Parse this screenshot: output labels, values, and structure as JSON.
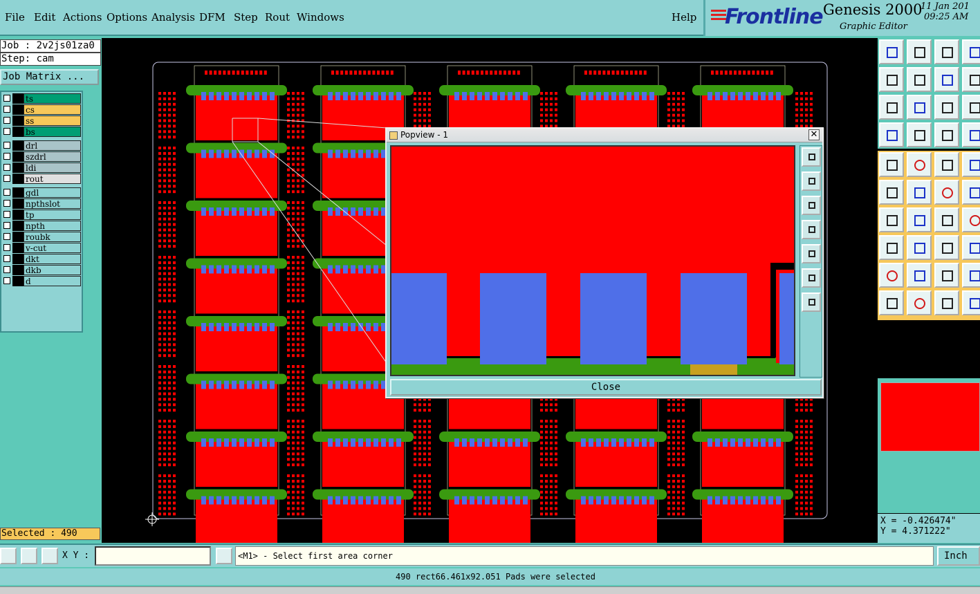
{
  "menu": {
    "items": [
      "File",
      "Edit",
      "Actions",
      "Options",
      "Analysis",
      "DFM",
      "Step",
      "Rout",
      "Windows"
    ],
    "help": "Help"
  },
  "brand": {
    "logo": "Frontline",
    "product": "Genesis 2000",
    "subtitle": "Graphic Editor",
    "date": "11 Jan 201",
    "time": "09:25 AM"
  },
  "job": {
    "job_label": "Job : 2v2js01za0",
    "step_label": "Step: cam",
    "matrix_button": "Job Matrix ..."
  },
  "layers": [
    {
      "name": "ts",
      "color": "#009e73"
    },
    {
      "name": "cs",
      "color": "#f7c85a"
    },
    {
      "name": "ss",
      "color": "#f7c85a"
    },
    {
      "name": "bs",
      "color": "#009e73"
    },
    {
      "name": "drl",
      "color": "#a9c4c8"
    },
    {
      "name": "szdrl",
      "color": "#a9c4c8"
    },
    {
      "name": "ldi",
      "color": "#a9c4c8"
    },
    {
      "name": "rout",
      "color": "#e0e0e0"
    },
    {
      "name": "gdl",
      "color": "#8fd3d3"
    },
    {
      "name": "npthslot",
      "color": "#8fd3d3"
    },
    {
      "name": "tp",
      "color": "#8fd3d3"
    },
    {
      "name": "npth",
      "color": "#8fd3d3"
    },
    {
      "name": "roubk",
      "color": "#8fd3d3"
    },
    {
      "name": "v-cut",
      "color": "#8fd3d3"
    },
    {
      "name": "dkt",
      "color": "#8fd3d3"
    },
    {
      "name": "dkb",
      "color": "#8fd3d3"
    },
    {
      "name": "d",
      "color": "#8fd3d3"
    }
  ],
  "selection": {
    "label": "Selected : 490"
  },
  "popview": {
    "title": "Popview - 1",
    "close_label": "Close",
    "close_x": "✕"
  },
  "coords": {
    "x": "X = -0.426474\"",
    "y": "Y = 4.371222\""
  },
  "command": {
    "xy_label": "X Y :",
    "xy_value": "",
    "prompt": "<M1> - Select first area corner",
    "unit": "Inch"
  },
  "status": {
    "message": "490 rect66.461x92.051 Pads were selected"
  },
  "colors": {
    "copper": "#ff0000",
    "pad": "#4f6fe8",
    "mask": "#3a9a10",
    "outline": "#c8c8e8"
  },
  "icons": [
    "zoom-home-icon",
    "zoom-in-icon",
    "zoom-out-icon",
    "pan-icon",
    "ruler-icon",
    "select-arrow-icon"
  ]
}
